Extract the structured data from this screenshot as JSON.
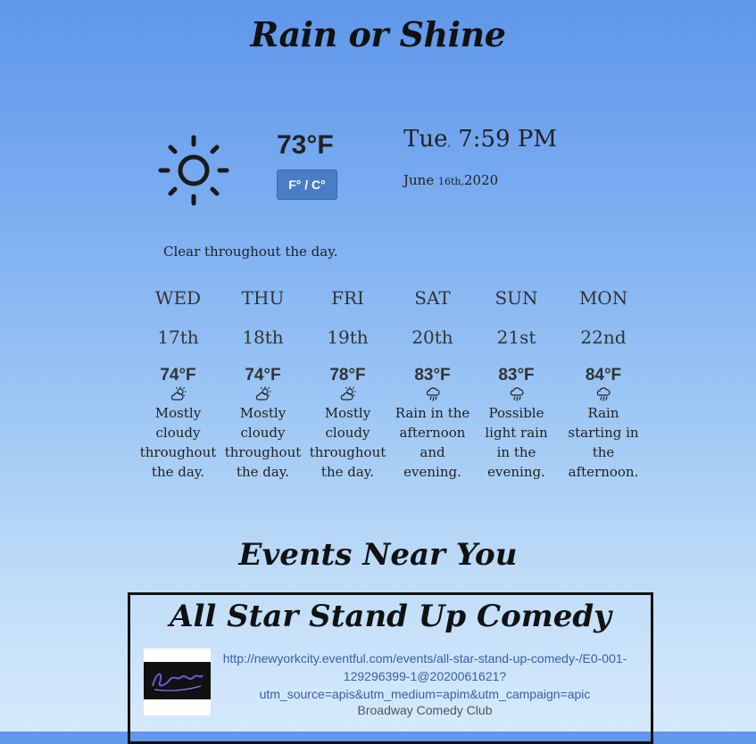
{
  "app": {
    "title": "Rain or Shine"
  },
  "current": {
    "temperature": "73°F",
    "unit_toggle_label": "F° / C°",
    "time": {
      "day": "Tue",
      "sep": ",",
      "clock": "7:59 PM"
    },
    "date": {
      "month_day": "June",
      "ordinal": "16th,",
      "year": "2020"
    },
    "summary": "Clear throughout the day.",
    "icon": "sun-icon"
  },
  "forecast": [
    {
      "day": "WED",
      "date": "17th",
      "temp": "74°F",
      "icon": "partly-cloudy-icon",
      "summary": "Mostly cloudy throughout the day."
    },
    {
      "day": "THU",
      "date": "18th",
      "temp": "74°F",
      "icon": "partly-cloudy-icon",
      "summary": "Mostly cloudy throughout the day."
    },
    {
      "day": "FRI",
      "date": "19th",
      "temp": "78°F",
      "icon": "partly-cloudy-icon",
      "summary": "Mostly cloudy throughout the day."
    },
    {
      "day": "SAT",
      "date": "20th",
      "temp": "83°F",
      "icon": "rain-icon",
      "summary": "Rain in the afternoon and evening."
    },
    {
      "day": "SUN",
      "date": "21st",
      "temp": "83°F",
      "icon": "rain-icon",
      "summary": "Possible light rain in the evening."
    },
    {
      "day": "MON",
      "date": "22nd",
      "temp": "84°F",
      "icon": "rain-icon",
      "summary": "Rain starting in the afternoon."
    }
  ],
  "events": {
    "title": "Events Near You",
    "items": [
      {
        "title": "All Star Stand Up Comedy",
        "url": "http://newyorkcity.eventful.com/events/all-star-stand-up-comedy-/E0-001-129296399-1@2020061621?utm_source=apis&utm_medium=apim&utm_campaign=apic",
        "venue": "Broadway Comedy Club",
        "thumbnail": "comedy-club-logo"
      }
    ]
  },
  "colors": {
    "accent_button": "#4a7ec4",
    "link": "#3a5ea8",
    "sky_top": "#5f97ea",
    "sky_bottom": "#d6e9fb"
  }
}
